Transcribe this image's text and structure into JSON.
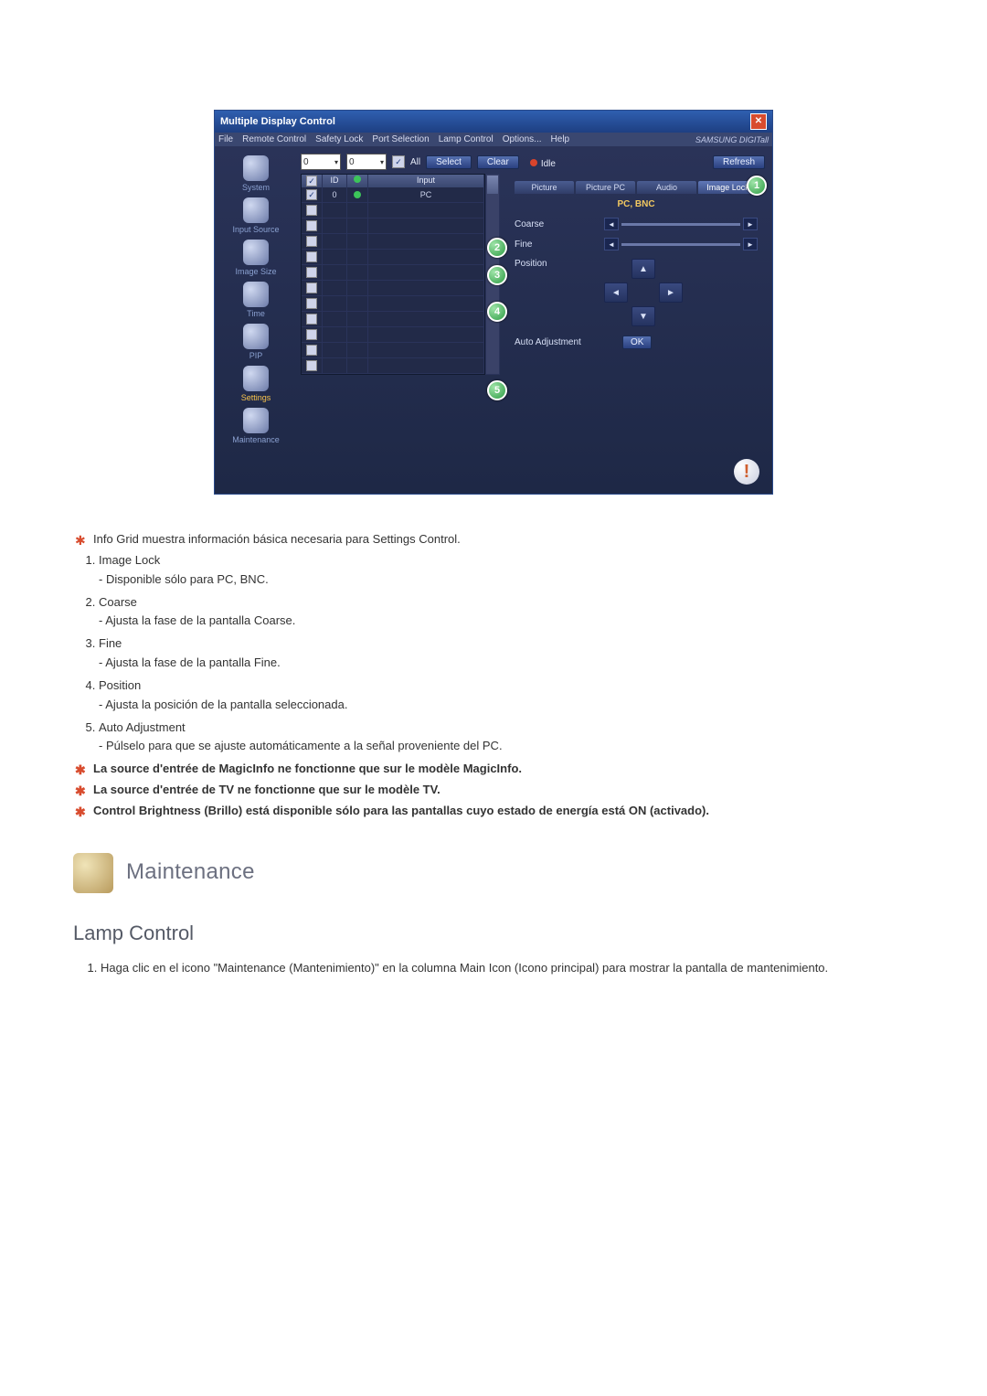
{
  "app": {
    "title": "Multiple Display Control",
    "menu": [
      "File",
      "Remote Control",
      "Safety Lock",
      "Port Selection",
      "Lamp Control",
      "Options...",
      "Help"
    ],
    "brand": "SAMSUNG DIGITall"
  },
  "sidebar": {
    "items": [
      {
        "label": "System"
      },
      {
        "label": "Input Source"
      },
      {
        "label": "Image Size"
      },
      {
        "label": "Time"
      },
      {
        "label": "PIP"
      },
      {
        "label": "Settings",
        "active": true
      },
      {
        "label": "Maintenance"
      }
    ]
  },
  "toolbar": {
    "dd1": "0",
    "dd2": "0",
    "all_label": "All",
    "select_label": "Select",
    "clear_label": "Clear",
    "status_label": "Idle",
    "refresh_label": "Refresh"
  },
  "grid": {
    "headers": {
      "sel": "",
      "id": "ID",
      "st": "",
      "input": "Input"
    },
    "rows": [
      {
        "checked": true,
        "id": "0",
        "st": "●",
        "input": "PC"
      },
      {
        "checked": false,
        "id": "",
        "st": "",
        "input": ""
      },
      {
        "checked": false,
        "id": "",
        "st": "",
        "input": ""
      },
      {
        "checked": false,
        "id": "",
        "st": "",
        "input": ""
      },
      {
        "checked": false,
        "id": "",
        "st": "",
        "input": ""
      },
      {
        "checked": false,
        "id": "",
        "st": "",
        "input": ""
      },
      {
        "checked": false,
        "id": "",
        "st": "",
        "input": ""
      },
      {
        "checked": false,
        "id": "",
        "st": "",
        "input": ""
      },
      {
        "checked": false,
        "id": "",
        "st": "",
        "input": ""
      },
      {
        "checked": false,
        "id": "",
        "st": "",
        "input": ""
      },
      {
        "checked": false,
        "id": "",
        "st": "",
        "input": ""
      },
      {
        "checked": false,
        "id": "",
        "st": "",
        "input": ""
      }
    ]
  },
  "tabs": {
    "items": [
      "Picture",
      "Picture PC",
      "Audio",
      "Image Lock"
    ],
    "active": 3
  },
  "settings": {
    "mode_label": "PC, BNC",
    "coarse_label": "Coarse",
    "fine_label": "Fine",
    "position_label": "Position",
    "auto_label": "Auto Adjustment",
    "ok_label": "OK"
  },
  "callouts": [
    "1",
    "2",
    "3",
    "4",
    "5"
  ],
  "doc": {
    "intro": "Info Grid muestra información básica necesaria para Settings Control.",
    "items": [
      {
        "title": "Image Lock",
        "desc": "Disponible sólo para PC, BNC."
      },
      {
        "title": "Coarse",
        "desc": "Ajusta la fase de la pantalla Coarse."
      },
      {
        "title": "Fine",
        "desc": "Ajusta la fase de la pantalla Fine."
      },
      {
        "title": "Position",
        "desc": "Ajusta la posición de la pantalla seleccionada."
      },
      {
        "title": "Auto Adjustment",
        "desc": "Púlselo para que se ajuste automáticamente a la señal proveniente del PC."
      }
    ],
    "notes": [
      "La source d'entrée de MagicInfo ne fonctionne que sur le modèle MagicInfo.",
      "La source d'entrée de TV ne fonctionne que sur le modèle TV.",
      "Control Brightness (Brillo) está disponible sólo para las pantallas cuyo estado de energía está ON (activado)."
    ],
    "section_title": "Maintenance",
    "sub_title": "Lamp Control",
    "step": "Haga clic en el icono \"Maintenance (Mantenimiento)\" en la columna Main Icon (Icono principal) para mostrar la pantalla de mantenimiento."
  }
}
